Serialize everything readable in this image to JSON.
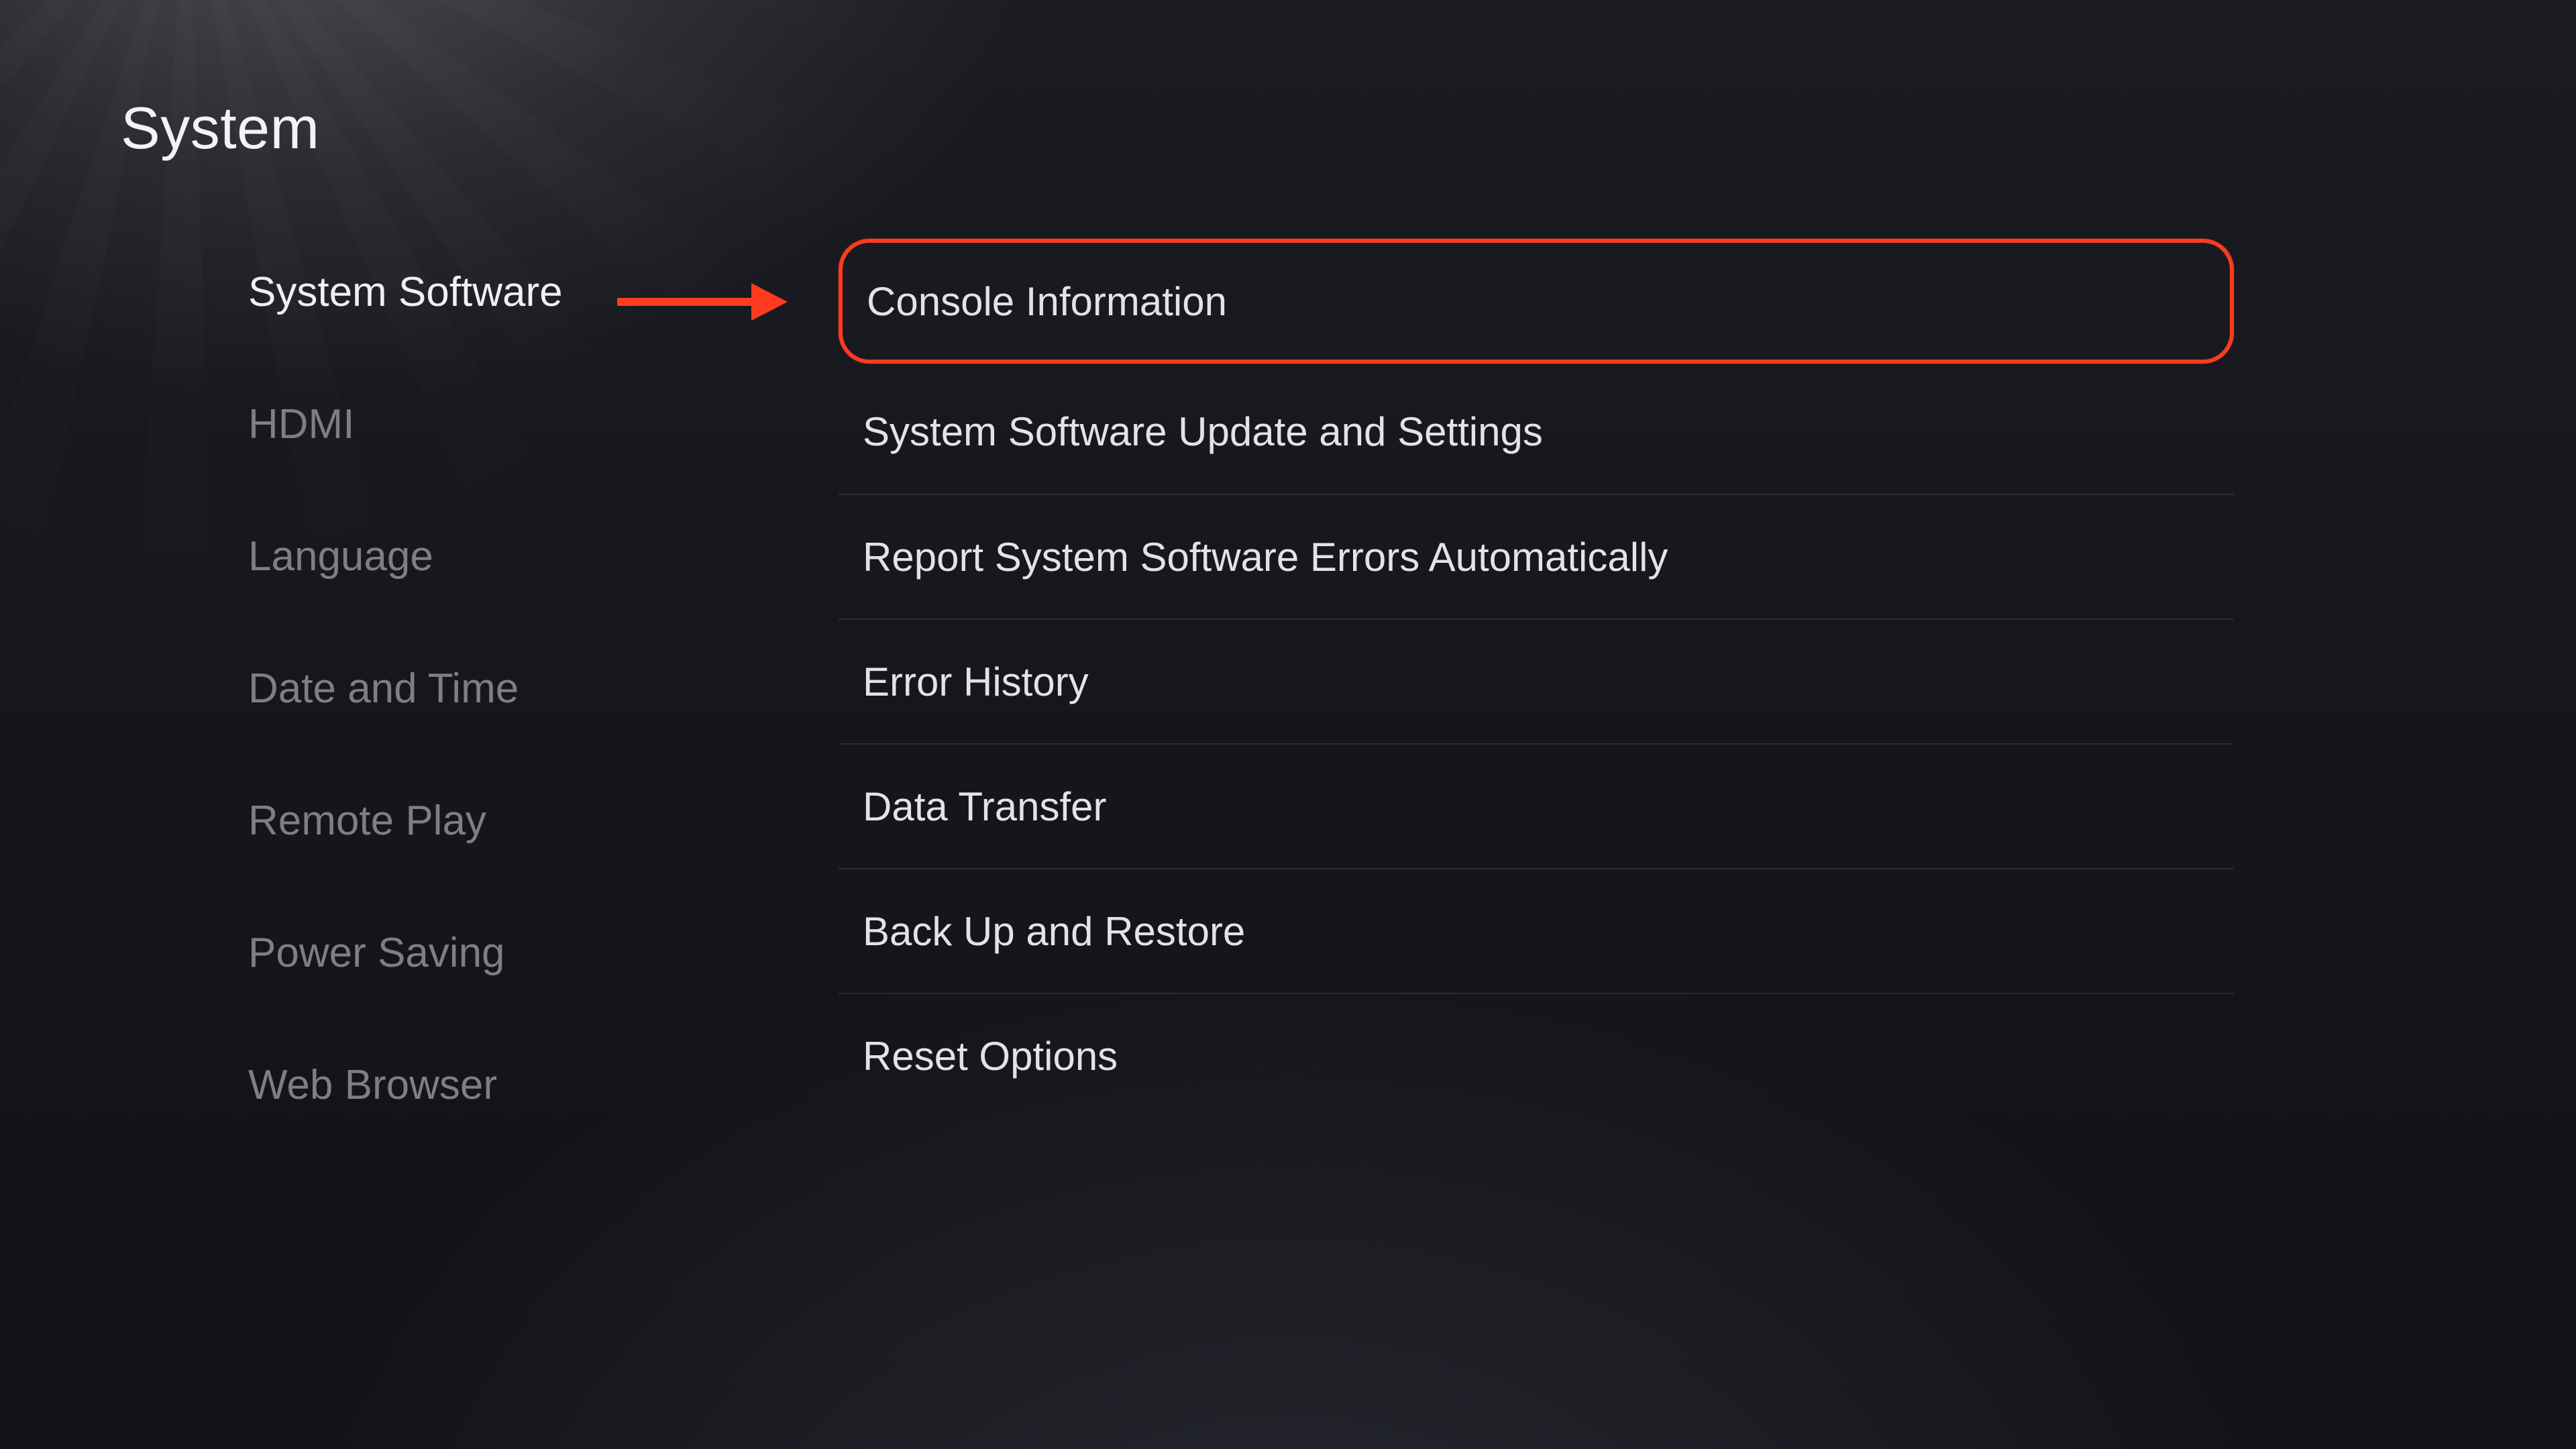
{
  "colors": {
    "highlight": "#ff3b1f",
    "text_primary": "#eef0f3",
    "text_secondary": "#7d7f85"
  },
  "header": {
    "title": "System"
  },
  "sidebar": {
    "active_index": 0,
    "items": [
      {
        "label": "System Software"
      },
      {
        "label": "HDMI"
      },
      {
        "label": "Language"
      },
      {
        "label": "Date and Time"
      },
      {
        "label": "Remote Play"
      },
      {
        "label": "Power Saving"
      },
      {
        "label": "Web Browser"
      }
    ]
  },
  "content": {
    "highlighted_index": 0,
    "items": [
      {
        "label": "Console Information"
      },
      {
        "label": "System Software Update and Settings"
      },
      {
        "label": "Report System Software Errors Automatically"
      },
      {
        "label": "Error History"
      },
      {
        "label": "Data Transfer"
      },
      {
        "label": "Back Up and Restore"
      },
      {
        "label": "Reset Options"
      }
    ]
  }
}
